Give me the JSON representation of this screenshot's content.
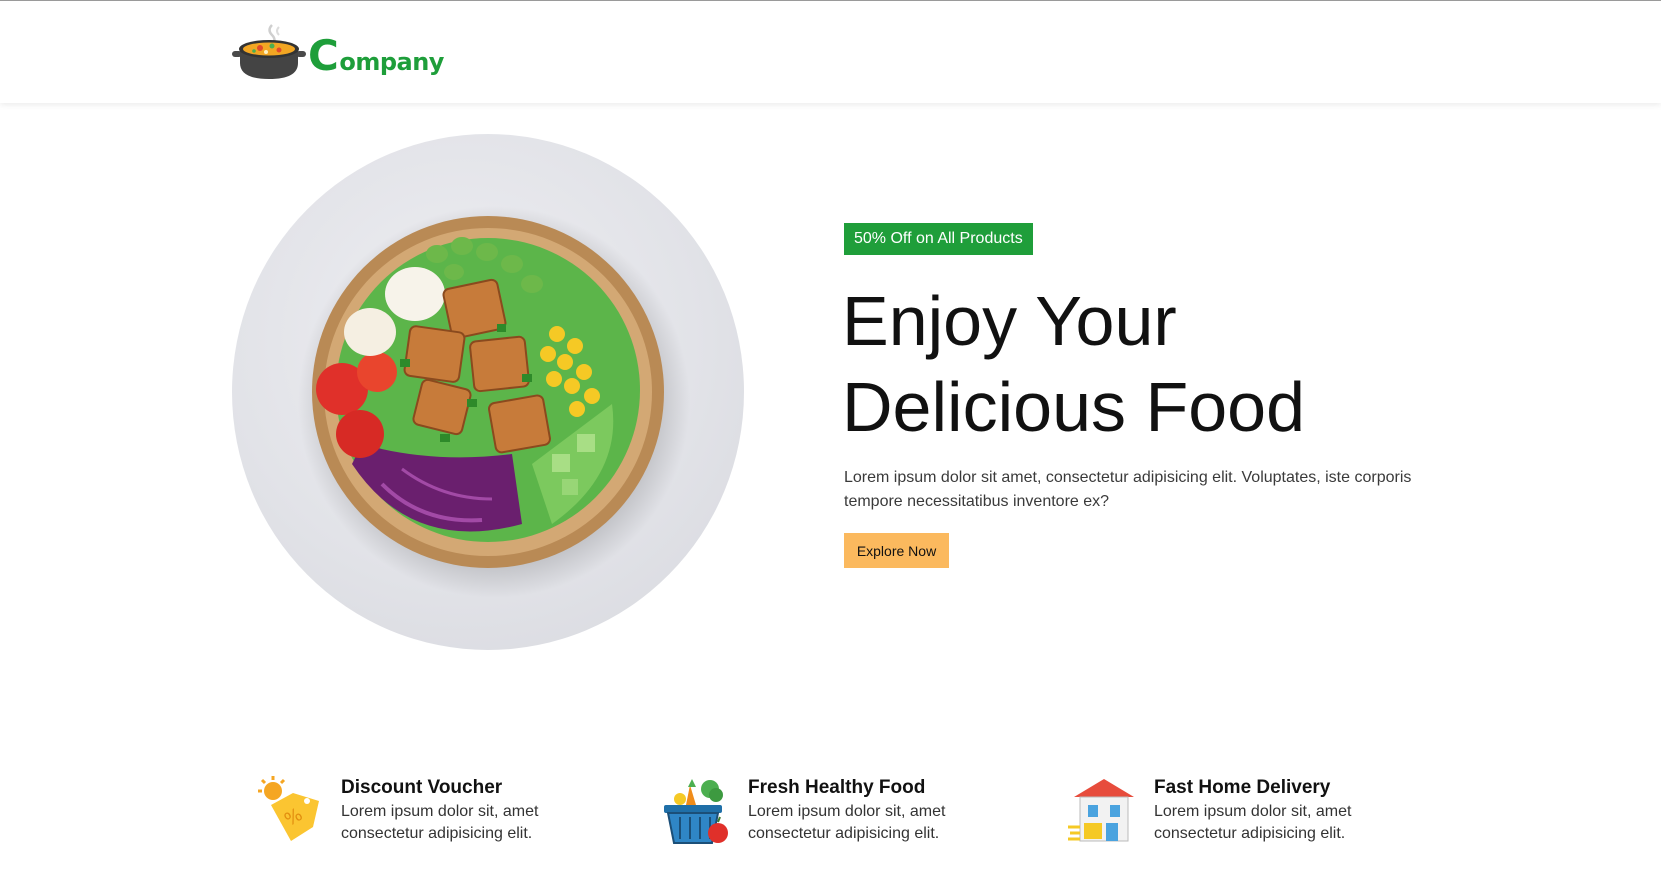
{
  "header": {
    "logo_initial": "C",
    "logo_rest": "ompany",
    "logo_icon": "cooking-pot-icon"
  },
  "hero": {
    "badge": "50% Off on All Products",
    "title_line1": "Enjoy Your",
    "title_line2": "Delicious Food",
    "description": "Lorem ipsum dolor sit amet, consectetur adipisicing elit. Voluptates, iste corporis tempore necessitatibus inventore ex?",
    "cta_label": "Explore Now",
    "image": "salad-bowl-image"
  },
  "features": [
    {
      "icon": "discount-tag-icon",
      "title": "Discount Voucher",
      "text": "Lorem ipsum dolor sit, amet consectetur adipisicing elit."
    },
    {
      "icon": "grocery-basket-icon",
      "title": "Fresh Healthy Food",
      "text": "Lorem ipsum dolor sit, amet consectetur adipisicing elit."
    },
    {
      "icon": "delivery-house-icon",
      "title": "Fast Home Delivery",
      "text": "Lorem ipsum dolor sit, amet consectetur adipisicing elit."
    }
  ],
  "colors": {
    "brand_green": "#1f9e3a",
    "cta_orange": "#fbb95e",
    "text_dark": "#111111"
  }
}
